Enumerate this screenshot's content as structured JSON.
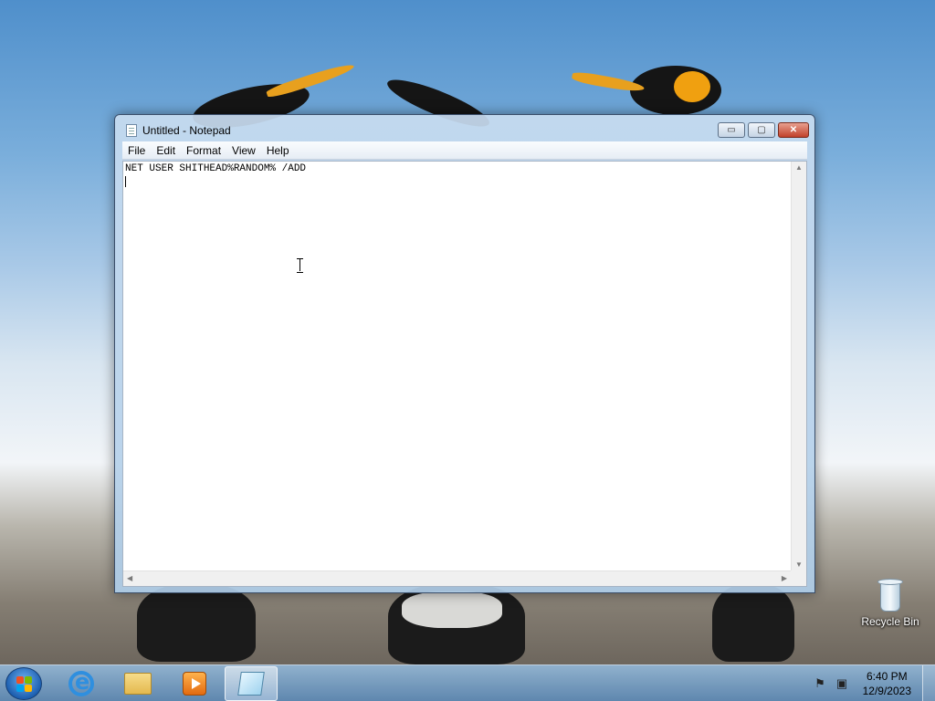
{
  "window": {
    "title": "Untitled - Notepad",
    "controls": {
      "minimize": "▭",
      "maximize": "▢",
      "close": "✕"
    }
  },
  "menu": {
    "items": [
      "File",
      "Edit",
      "Format",
      "View",
      "Help"
    ]
  },
  "editor": {
    "text": "NET USER SHITHEAD%RANDOM% /ADD"
  },
  "desktop": {
    "recycle_bin_label": "Recycle Bin"
  },
  "taskbar": {
    "pinned": [
      {
        "name": "internet-explorer",
        "icon": "ie-icon"
      },
      {
        "name": "windows-explorer",
        "icon": "folder-icon"
      },
      {
        "name": "media-player",
        "icon": "media-player-icon"
      },
      {
        "name": "notepad",
        "icon": "notepad-icon",
        "active": true
      }
    ],
    "clock": {
      "time": "6:40 PM",
      "date": "12/9/2023"
    }
  }
}
